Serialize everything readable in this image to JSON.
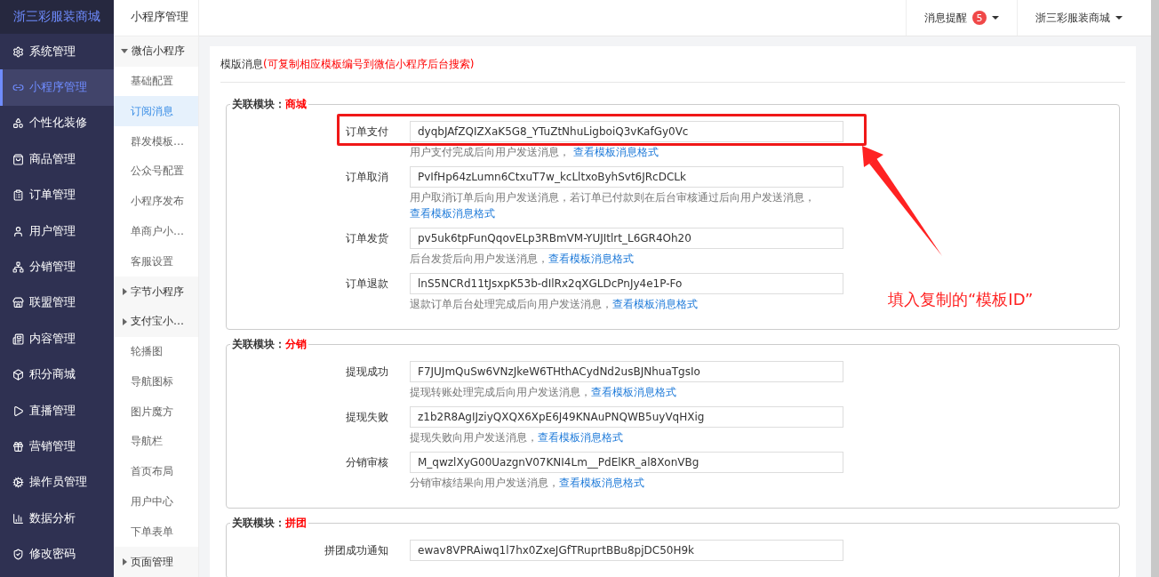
{
  "brand": "浙三彩服装商城",
  "main_nav": [
    {
      "label": "系统管理",
      "selected": false
    },
    {
      "label": "小程序管理",
      "selected": true
    },
    {
      "label": "个性化装修",
      "selected": false
    },
    {
      "label": "商品管理",
      "selected": false
    },
    {
      "label": "订单管理",
      "selected": false
    },
    {
      "label": "用户管理",
      "selected": false
    },
    {
      "label": "分销管理",
      "selected": false
    },
    {
      "label": "联盟管理",
      "selected": false
    },
    {
      "label": "内容管理",
      "selected": false
    },
    {
      "label": "积分商城",
      "selected": false
    },
    {
      "label": "直播管理",
      "selected": false
    },
    {
      "label": "营销管理",
      "selected": false
    },
    {
      "label": "操作员管理",
      "selected": false
    },
    {
      "label": "数据分析",
      "selected": false
    },
    {
      "label": "修改密码",
      "selected": false
    }
  ],
  "sub_nav": {
    "title": "小程序管理",
    "items": [
      {
        "kind": "group",
        "label": "微信小程序",
        "expanded": true,
        "children": [
          {
            "label": "基础配置",
            "selected": false
          },
          {
            "label": "订阅消息",
            "selected": true
          },
          {
            "label": "群发模板…",
            "selected": false
          },
          {
            "label": "公众号配置",
            "selected": false
          },
          {
            "label": "小程序发布",
            "selected": false
          },
          {
            "label": "单商户小…",
            "selected": false
          },
          {
            "label": "客服设置",
            "selected": false
          }
        ]
      },
      {
        "kind": "group",
        "label": "字节小程序",
        "expanded": false
      },
      {
        "kind": "group",
        "label": "支付宝小…",
        "expanded": false
      },
      {
        "kind": "link",
        "label": "轮播图",
        "selected": false
      },
      {
        "kind": "link",
        "label": "导航图标",
        "selected": false
      },
      {
        "kind": "link",
        "label": "图片魔方",
        "selected": false
      },
      {
        "kind": "link",
        "label": "导航栏",
        "selected": false
      },
      {
        "kind": "link",
        "label": "首页布局",
        "selected": false
      },
      {
        "kind": "link",
        "label": "用户中心",
        "selected": false
      },
      {
        "kind": "link",
        "label": "下单表单",
        "selected": false
      },
      {
        "kind": "group",
        "label": "页面管理",
        "expanded": false
      }
    ]
  },
  "top_bar": {
    "notifications": {
      "label": "消息提醒",
      "count": "5"
    },
    "account": "浙三彩服装商城"
  },
  "card": {
    "title": "模版消息",
    "hint": "(可复制相应模板编号到微信小程序后台搜索)",
    "sections": [
      {
        "legend": "关联模块：",
        "module": "商城",
        "fields": [
          {
            "label": "订单支付",
            "value": "dyqbJAfZQIZXaK5G8_YTuZtNhuLigboiQ3vKafGy0Vc",
            "help": "用户支付完成后向用户发送消息， ",
            "link": "查看模板消息格式",
            "highlighted": true
          },
          {
            "label": "订单取消",
            "value": "PvIfHp64zLumn6CtxuT7w_kcLltxoByhSvt6JRcDCLk",
            "help": "用户取消订单后向用户发送消息，若订单已付款则在后台审核通过后向用户发送消息，",
            "link": "查看模板消息格式",
            "highlighted": false
          },
          {
            "label": "订单发货",
            "value": "pv5uk6tpFunQqovELp3RBmVM-YUJItlrt_L6GR4Oh20",
            "help": "后台发货后向用户发送消息，",
            "link": "查看模板消息格式",
            "highlighted": false
          },
          {
            "label": "订单退款",
            "value": "lnS5NCRd11tJsxpK53b-dIlRx2qXGLDcPnJy4e1P-Fo",
            "help": "退款订单后台处理完成后向用户发送消息，",
            "link": "查看模板消息格式",
            "highlighted": false
          }
        ]
      },
      {
        "legend": "关联模块：",
        "module": "分销",
        "fields": [
          {
            "label": "提现成功",
            "value": "F7JUJmQuSw6VNzJkeW6THthACydNd2usBJNhuaTgsIo",
            "help": "提现转账处理完成后向用户发送消息，",
            "link": "查看模板消息格式",
            "highlighted": false
          },
          {
            "label": "提现失败",
            "value": "z1b2R8AgIJziyQXQX6XpE6J49KNAuPNQWB5uyVqHXig",
            "help": "提现失败向用户发送消息，",
            "link": "查看模板消息格式",
            "highlighted": false
          },
          {
            "label": "分销审核",
            "value": "M_qwzlXyG00UazgnV07KNI4Lm__PdElKR_al8XonVBg",
            "help": "分销审核结果向用户发送消息，",
            "link": "查看模板消息格式",
            "highlighted": false
          }
        ]
      },
      {
        "legend": "关联模块：",
        "module": "拼团",
        "fields": [
          {
            "label": "拼团成功通知",
            "value": "ewav8VPRAiwq1l7hx0ZxeJGfTRuprtBBu8pjDC50H9k",
            "highlighted": false
          }
        ]
      }
    ]
  },
  "annotation": {
    "note": "填入复制的“模板ID”"
  }
}
